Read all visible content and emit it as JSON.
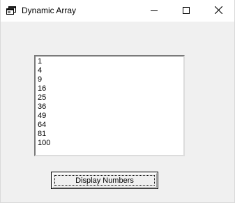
{
  "window": {
    "title": "Dynamic Array",
    "icons": {
      "app": "app-window-icon",
      "minimize": "minimize-icon",
      "maximize": "maximize-icon",
      "close": "close-icon"
    }
  },
  "listbox": {
    "items": [
      "1",
      "4",
      "9",
      "16",
      "25",
      "36",
      "49",
      "64",
      "81",
      "100"
    ]
  },
  "buttons": {
    "display_numbers_label": "Display Numbers"
  }
}
